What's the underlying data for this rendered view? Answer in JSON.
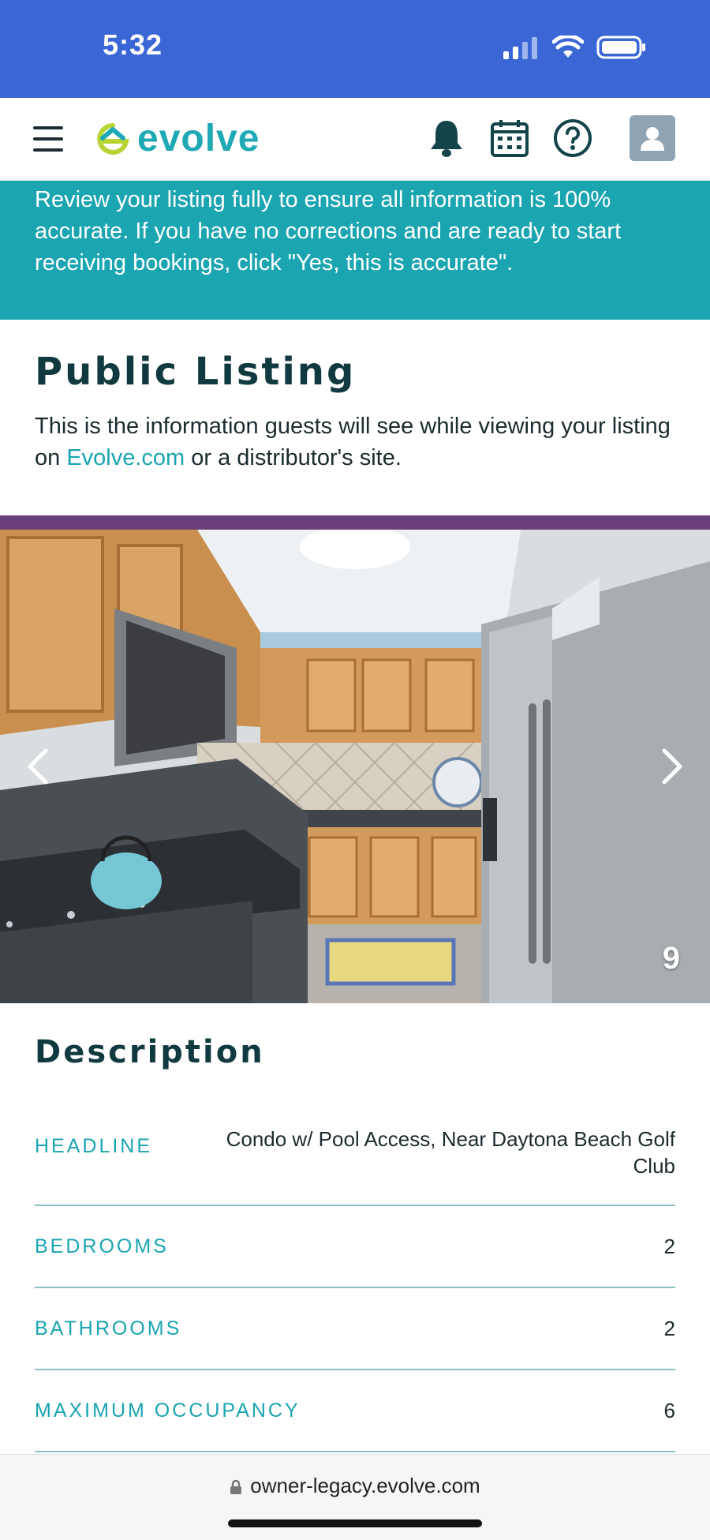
{
  "status_bar": {
    "time": "5:32"
  },
  "header": {
    "logo_text": "evolve"
  },
  "banner": {
    "text": "Review your listing fully to ensure all information is 100% accurate. If you have no corrections and are ready to start receiving bookings, click \"Yes, this is accurate\"."
  },
  "public_listing": {
    "title": "Public Listing",
    "desc_before": "This is the information guests will see while viewing your listing on ",
    "desc_link": "Evolve.com",
    "desc_after": " or a distributor's site."
  },
  "photo": {
    "count": "9"
  },
  "description": {
    "title": "Description",
    "rows": [
      {
        "label": "HEADLINE",
        "value": "Condo w/ Pool Access, Near Daytona Beach Golf Club"
      },
      {
        "label": "BEDROOMS",
        "value": "2"
      },
      {
        "label": "BATHROOMS",
        "value": "2"
      },
      {
        "label": "MAXIMUM OCCUPANCY",
        "value": "6"
      }
    ]
  },
  "browser": {
    "url": "owner-legacy.evolve.com"
  },
  "colors": {
    "brand": "#1aa5b1",
    "status_bar": "#3a66d6",
    "accent_rule": "#6a3f7a",
    "heading": "#113a40"
  }
}
